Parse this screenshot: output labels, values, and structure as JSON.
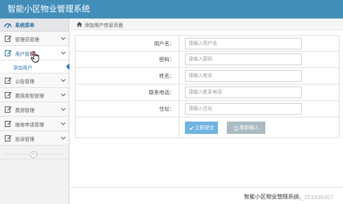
{
  "app": {
    "title": "智能小区物业管理系统"
  },
  "sidebar": {
    "header": {
      "label": "系统菜单",
      "icon": "speedometer-icon"
    },
    "items": [
      {
        "label": "管理员管理",
        "icon": "edit-icon"
      },
      {
        "label": "用户管理",
        "icon": "edit-icon",
        "expanded": true,
        "subitems": [
          {
            "label": "添加用户",
            "selected": true
          }
        ]
      },
      {
        "label": "公告管理",
        "icon": "edit-icon"
      },
      {
        "label": "费用类型管理",
        "icon": "edit-icon"
      },
      {
        "label": "费用管理",
        "icon": "edit-icon"
      },
      {
        "label": "维修申请管理",
        "icon": "edit-icon"
      },
      {
        "label": "投诉管理",
        "icon": "edit-icon"
      }
    ],
    "collapse_glyph": "«"
  },
  "breadcrumb": {
    "icon": "home-icon",
    "text": "添加用户信息页面"
  },
  "form": {
    "fields": [
      {
        "label": "用户名：",
        "placeholder": "请输入用户名",
        "value": ""
      },
      {
        "label": "密码：",
        "placeholder": "请输入密码",
        "value": ""
      },
      {
        "label": "姓名：",
        "placeholder": "请输入姓名",
        "value": ""
      },
      {
        "label": "联系电话：",
        "placeholder": "请输入联系电话",
        "value": ""
      },
      {
        "label": "住址：",
        "placeholder": "请输入住址",
        "value": ""
      }
    ],
    "submit_label": "立即提交",
    "reset_label": "重新输入"
  },
  "footer": {
    "text": "智能小区物业管理系统"
  },
  "watermark": {
    "text": "CSDN @q_251836457"
  },
  "colors": {
    "topbar": "#438eb9",
    "submit": "#6fb3e0",
    "reset": "#abbac3",
    "link": "#2b7dbc"
  }
}
